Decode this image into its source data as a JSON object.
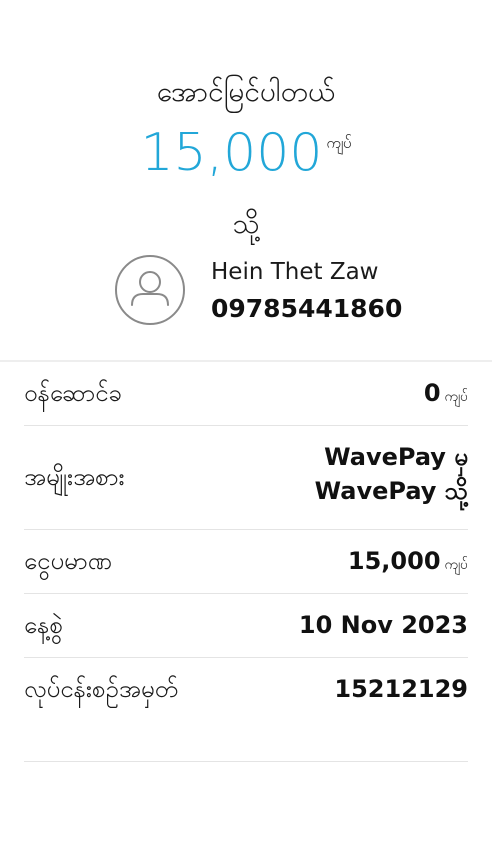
{
  "header": {
    "status": "အောင်မြင်ပါတယ်",
    "amount": "15,000",
    "amount_unit": "ကျပ်",
    "to_label": "သို့"
  },
  "recipient": {
    "avatar_icon": "user-avatar-icon",
    "name": "Hein Thet Zaw",
    "phone": "09785441860"
  },
  "details": {
    "fee_label": "ဝန်ဆောင်ခ",
    "fee_value": "0",
    "fee_unit": "ကျပ်",
    "type_label": "အမျိုးအစား",
    "type_value": "WavePay မှ WavePay သို့",
    "amount_label": "ငွေပမာဏ",
    "amount_value": "15,000",
    "amount_unit": "ကျပ်",
    "date_label": "နေ့စွဲ",
    "date_value": "10 Nov 2023",
    "txn_label": "လုပ်ငန်းစဉ်အမှတ်",
    "txn_value": "15212129"
  },
  "colors": {
    "accent": "#22a7d8",
    "divider": "#e4e4e4",
    "avatar_border": "#8a8a8a"
  }
}
